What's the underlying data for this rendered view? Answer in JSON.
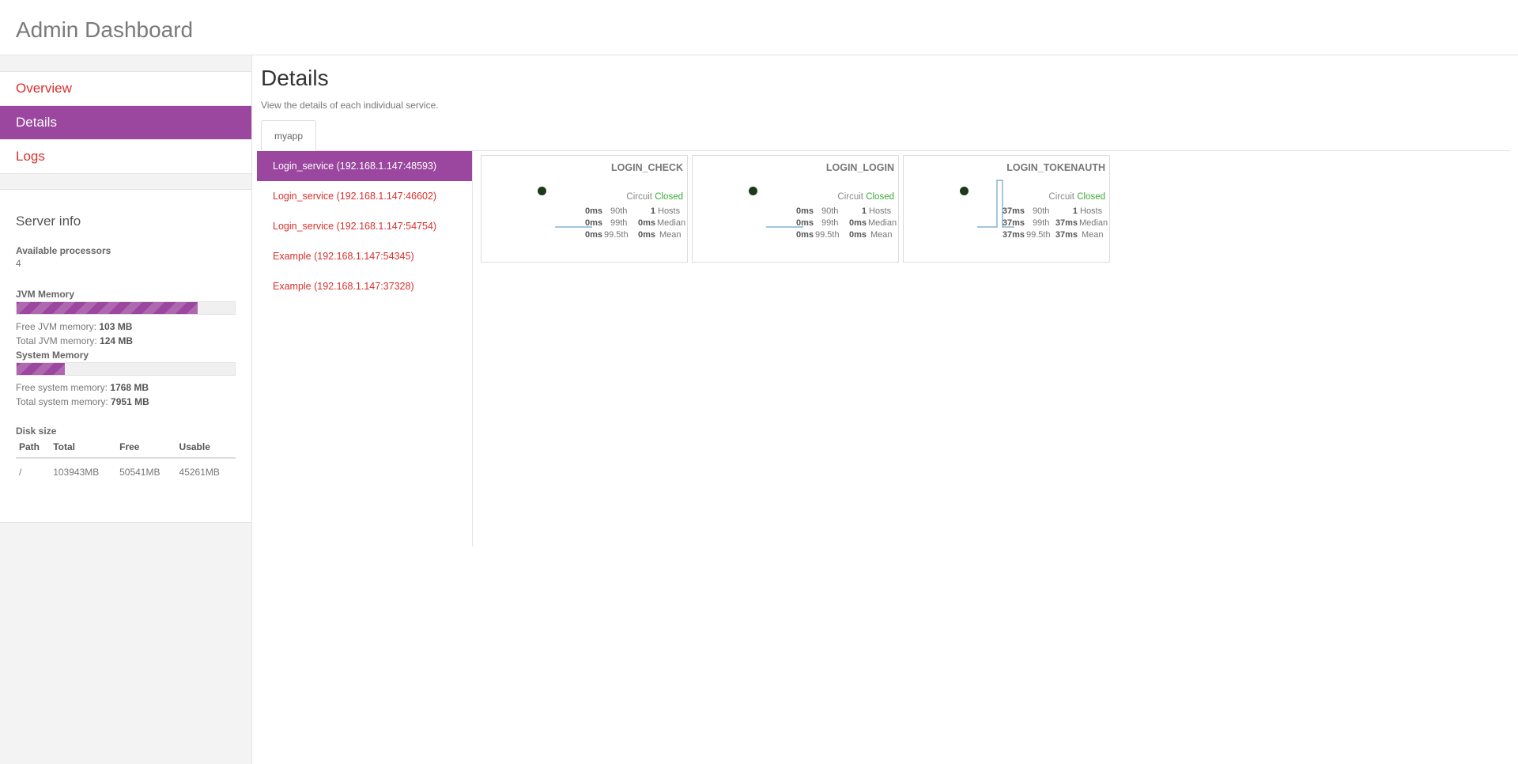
{
  "header": {
    "title": "Admin Dashboard"
  },
  "nav": {
    "items": [
      {
        "label": "Overview"
      },
      {
        "label": "Details"
      },
      {
        "label": "Logs"
      }
    ]
  },
  "server_info": {
    "title": "Server info",
    "available_processors_label": "Available processors",
    "available_processors": "4",
    "jvm_memory_label": "JVM Memory",
    "jvm_memory_used_fraction": 0.83,
    "free_jvm_label": "Free JVM memory:",
    "free_jvm_value": "103 MB",
    "total_jvm_label": "Total JVM memory:",
    "total_jvm_value": "124 MB",
    "system_memory_label": "System Memory",
    "system_memory_used_fraction": 0.22,
    "free_sys_label": "Free system memory:",
    "free_sys_value": "1768 MB",
    "total_sys_label": "Total system memory:",
    "total_sys_value": "7951 MB",
    "disk_label": "Disk size",
    "disk_headers": [
      "Path",
      "Total",
      "Free",
      "Usable"
    ],
    "disk_rows": [
      [
        "/",
        "103943MB",
        "50541MB",
        "45261MB"
      ]
    ]
  },
  "details": {
    "title": "Details",
    "subtitle": "View the details of each individual service.",
    "tab": "myapp"
  },
  "services": [
    {
      "label": "Login_service (192.168.1.147:48593)"
    },
    {
      "label": "Login_service (192.168.1.147:46602)"
    },
    {
      "label": "Login_service (192.168.1.147:54754)"
    },
    {
      "label": "Example (192.168.1.147:54345)"
    },
    {
      "label": "Example (192.168.1.147:37328)"
    }
  ],
  "cards": [
    {
      "title": "LOGIN_CHECK",
      "circuit_label": "Circuit",
      "circuit_status": "Closed",
      "p90": "0ms",
      "p90_label": "90th",
      "hosts": "1",
      "hosts_label": "Hosts",
      "p99": "0ms",
      "p99_label": "99th",
      "median": "0ms",
      "median_label": "Median",
      "p995": "0ms",
      "p995_label": "99.5th",
      "mean": "0ms",
      "mean_label": "Mean"
    },
    {
      "title": "LOGIN_LOGIN",
      "circuit_label": "Circuit",
      "circuit_status": "Closed",
      "p90": "0ms",
      "p90_label": "90th",
      "hosts": "1",
      "hosts_label": "Hosts",
      "p99": "0ms",
      "p99_label": "99th",
      "median": "0ms",
      "median_label": "Median",
      "p995": "0ms",
      "p995_label": "99.5th",
      "mean": "0ms",
      "mean_label": "Mean"
    },
    {
      "title": "LOGIN_TOKENAUTH",
      "circuit_label": "Circuit",
      "circuit_status": "Closed",
      "p90": "37ms",
      "p90_label": "90th",
      "hosts": "1",
      "hosts_label": "Hosts",
      "p99": "37ms",
      "p99_label": "99th",
      "median": "37ms",
      "median_label": "Median",
      "p995": "37ms",
      "p995_label": "99.5th",
      "mean": "37ms",
      "mean_label": "Mean"
    }
  ],
  "colors": {
    "accent": "#9b479f",
    "link": "#d8302d",
    "closed": "#3aaa35"
  }
}
